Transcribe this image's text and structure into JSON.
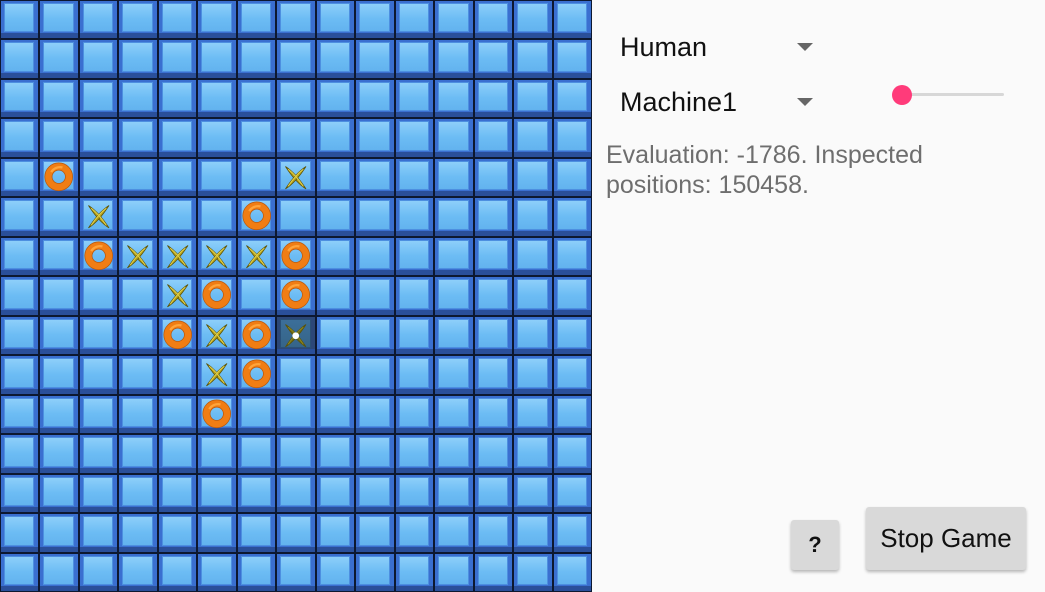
{
  "board": {
    "size": 15,
    "colors": {
      "x_piece": "#b5a11c",
      "x_piece_dark": "#6f6a12",
      "o_piece": "#f07d14",
      "o_piece_light": "#ffa43a",
      "tile": "#6cbcf4",
      "tile_border": "#2a4f9a"
    },
    "pieces": [
      {
        "row": 4,
        "col": 1,
        "type": "O"
      },
      {
        "row": 4,
        "col": 7,
        "type": "X"
      },
      {
        "row": 5,
        "col": 2,
        "type": "X"
      },
      {
        "row": 5,
        "col": 6,
        "type": "O"
      },
      {
        "row": 6,
        "col": 2,
        "type": "O"
      },
      {
        "row": 6,
        "col": 3,
        "type": "X"
      },
      {
        "row": 6,
        "col": 4,
        "type": "X"
      },
      {
        "row": 6,
        "col": 5,
        "type": "X"
      },
      {
        "row": 6,
        "col": 6,
        "type": "X"
      },
      {
        "row": 6,
        "col": 7,
        "type": "O"
      },
      {
        "row": 7,
        "col": 4,
        "type": "X"
      },
      {
        "row": 7,
        "col": 5,
        "type": "O"
      },
      {
        "row": 7,
        "col": 7,
        "type": "O"
      },
      {
        "row": 8,
        "col": 4,
        "type": "O"
      },
      {
        "row": 8,
        "col": 5,
        "type": "X"
      },
      {
        "row": 8,
        "col": 6,
        "type": "O"
      },
      {
        "row": 8,
        "col": 7,
        "type": "X",
        "last_move": true
      },
      {
        "row": 9,
        "col": 5,
        "type": "X"
      },
      {
        "row": 9,
        "col": 6,
        "type": "O"
      },
      {
        "row": 10,
        "col": 5,
        "type": "O"
      }
    ]
  },
  "panel": {
    "player1": {
      "selected": "Human",
      "icon": "dropdown-caret-icon"
    },
    "player2": {
      "selected": "Machine1",
      "icon": "dropdown-caret-icon"
    },
    "strength_slider": {
      "value": 0,
      "min": 0,
      "max": 1,
      "accent": "#ff4081"
    },
    "status_text": "Evaluation: -1786. Inspected positions: 150458.",
    "help_button_label": "?",
    "stop_button_label": "Stop Game"
  }
}
